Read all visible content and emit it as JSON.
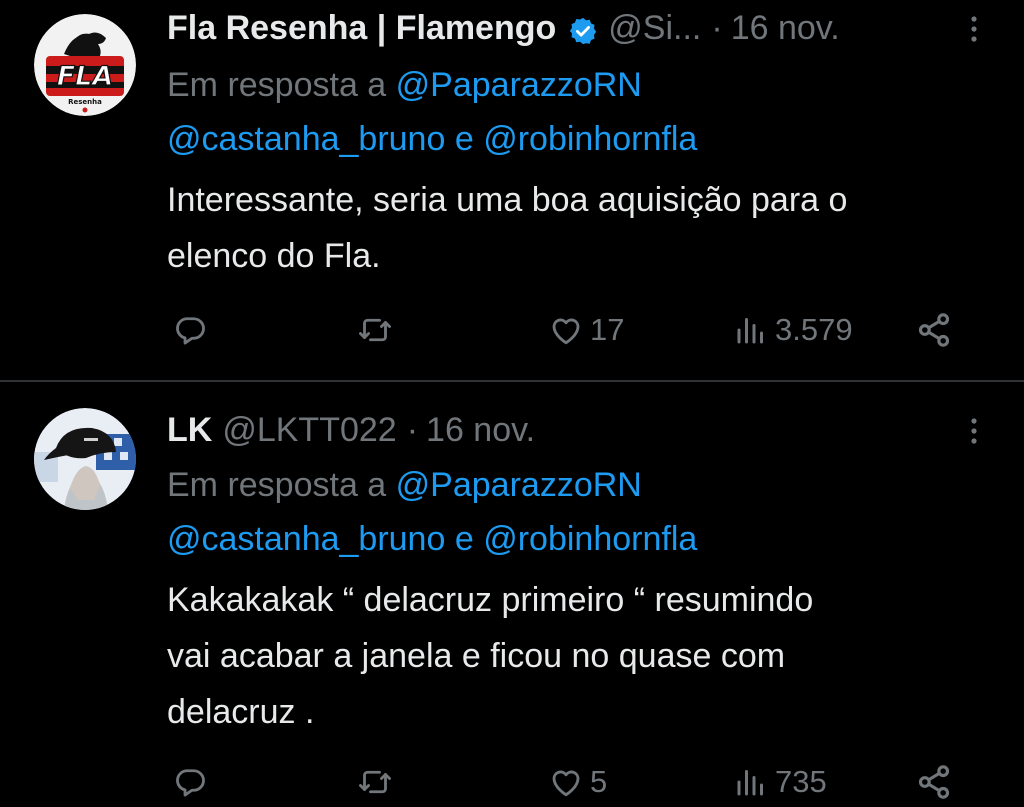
{
  "colors": {
    "background": "#000000",
    "primary_text": "#e7e9ea",
    "secondary_text": "#71767b",
    "link": "#1d9bf0",
    "verified": "#1d9bf0",
    "divider": "#2f3336"
  },
  "tweets": [
    {
      "display_name": "Fla Resenha | Flamengo",
      "verified": true,
      "handle": "@Si...",
      "separator": "·",
      "time": "16 nov.",
      "reply_prefix": "Em resposta a",
      "mention_1": "@PaparazzoRN",
      "mention_2": "@castanha_bruno",
      "conjunction": "e",
      "mention_3": "@robinhornfla",
      "text_lines": [
        "Interessante, seria uma boa aquisição para o",
        "elenco do Fla."
      ],
      "avatar_logo_text": "FLA",
      "avatar_sub_text": "Resenha",
      "likes": "17",
      "views": "3.579",
      "icons": {
        "reply": "reply-icon",
        "retweet": "retweet-icon",
        "like": "heart-icon",
        "views": "views-icon",
        "share": "share-icon",
        "more": "more-icon"
      }
    },
    {
      "display_name": "LK",
      "verified": false,
      "handle": "@LKTT022",
      "separator": "·",
      "time": "16 nov.",
      "reply_prefix": "Em resposta a",
      "mention_1": "@PaparazzoRN",
      "mention_2": "@castanha_bruno",
      "conjunction": "e",
      "mention_3": "@robinhornfla",
      "text_lines": [
        "Kakakakak “ delacruz primeiro “ resumindo",
        "vai acabar a janela e ficou no quase com",
        "delacruz ."
      ],
      "likes": "5",
      "views": "735",
      "icons": {
        "reply": "reply-icon",
        "retweet": "retweet-icon",
        "like": "heart-icon",
        "views": "views-icon",
        "share": "share-icon",
        "more": "more-icon"
      }
    }
  ]
}
